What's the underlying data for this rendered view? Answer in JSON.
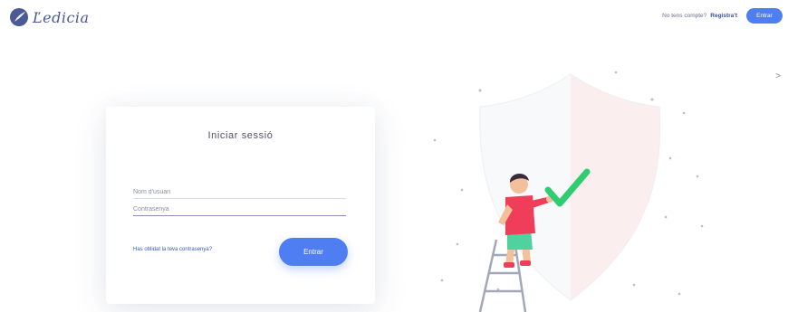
{
  "header": {
    "logo_text": "Ľedicia",
    "no_account_text": "No tens compte?",
    "register_link": "Registra't",
    "top_button_label": "Entrar"
  },
  "login": {
    "title": "Iniciar sessió",
    "username_placeholder": "Nom d'usuari",
    "password_placeholder": "Contrasenya",
    "forgot_link": "Has oblidat la teva contrasenya?",
    "submit_label": "Entrar"
  },
  "side_arrow": ">",
  "colors": {
    "accent": "#4f7ef2",
    "brand": "#4a5a98",
    "shield_right": "#fbeeee",
    "check": "#2fcc71",
    "person_shirt": "#f03e5a",
    "person_shorts": "#4fd1a0"
  },
  "icons": {
    "logo": "feather-circle-icon",
    "arrow": "chevron-right-icon",
    "checkmark": "checkmark-icon"
  }
}
